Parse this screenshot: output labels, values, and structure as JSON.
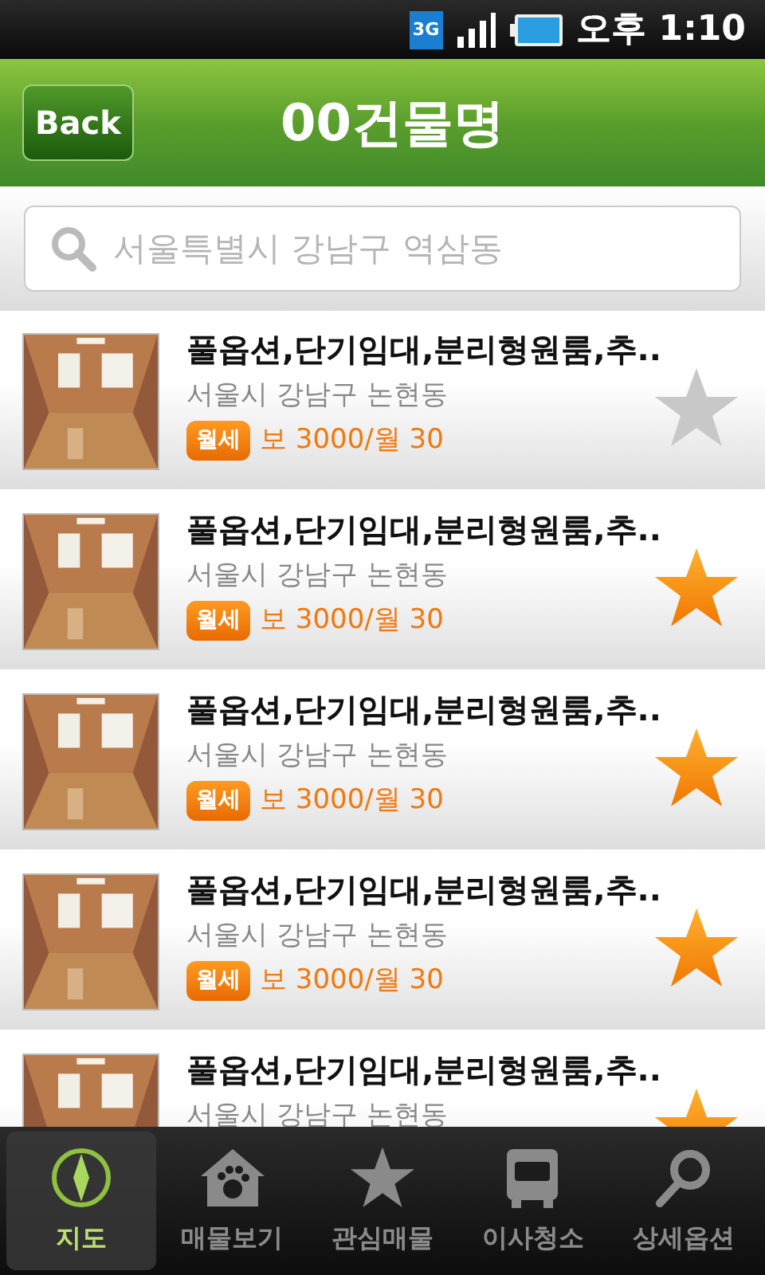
{
  "status_bar": {
    "network": "3G",
    "time": "오후 1:10"
  },
  "header": {
    "back": "Back",
    "title": "00건물명"
  },
  "search": {
    "placeholder": "서울특별시 강남구 역삼동"
  },
  "listings": [
    {
      "title": "풀옵션,단기임대,분리형원룸,추..",
      "address": "서울시 강남구 논현동",
      "badge": "월세",
      "price": "보 3000/월 30",
      "favorite": false
    },
    {
      "title": "풀옵션,단기임대,분리형원룸,추..",
      "address": "서울시 강남구 논현동",
      "badge": "월세",
      "price": "보 3000/월 30",
      "favorite": true
    },
    {
      "title": "풀옵션,단기임대,분리형원룸,추..",
      "address": "서울시 강남구 논현동",
      "badge": "월세",
      "price": "보 3000/월 30",
      "favorite": true
    },
    {
      "title": "풀옵션,단기임대,분리형원룸,추..",
      "address": "서울시 강남구 논현동",
      "badge": "월세",
      "price": "보 3000/월 30",
      "favorite": true
    },
    {
      "title": "풀옵션,단기임대,분리형원룸,추..",
      "address": "서울시 강남구 논현동",
      "favorite": true
    }
  ],
  "tab_bar": [
    {
      "label": "지도",
      "kind": "compass",
      "selected": true
    },
    {
      "label": "매물보기",
      "kind": "house",
      "selected": false
    },
    {
      "label": "관심매물",
      "kind": "star",
      "selected": false
    },
    {
      "label": "이사청소",
      "kind": "truck",
      "selected": false
    },
    {
      "label": "상세옵션",
      "kind": "search",
      "selected": false
    }
  ]
}
